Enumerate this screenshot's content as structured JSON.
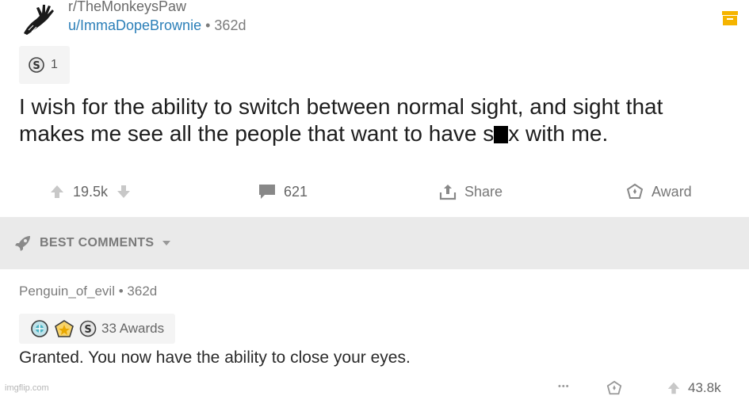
{
  "post": {
    "subreddit": "r/TheMonkeysPaw",
    "author": "u/ImmaDopeBrownie",
    "separator": "•",
    "age": "362d",
    "award_count": "1",
    "title_part1": "I wish for the ability to switch between normal sight, and sight that makes me see all the people that want to have s",
    "title_part2": "x with me.",
    "upvotes": "19.5k",
    "comments": "621",
    "share_label": "Share",
    "award_label": "Award"
  },
  "best_comments": {
    "label": "BEST COMMENTS"
  },
  "comment": {
    "author": "Penguin_of_evil",
    "separator": "•",
    "age": "362d",
    "awards_label": "33 Awards",
    "body": "Granted. You now have the ability to close your eyes.",
    "more": "•••",
    "score": "43.8k"
  },
  "watermark": "imgflip.com",
  "colors": {
    "username": "#2b7fb8",
    "save_icon": "#f5b400",
    "best_bar_bg": "#eaeaea"
  }
}
